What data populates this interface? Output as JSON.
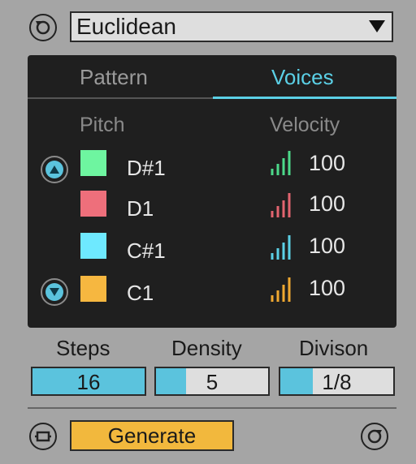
{
  "header": {
    "preset_value": "Euclidean"
  },
  "tabs": [
    {
      "label": "Pattern",
      "active": false
    },
    {
      "label": "Voices",
      "active": true
    }
  ],
  "columns": {
    "pitch": "Pitch",
    "velocity": "Velocity"
  },
  "voices": [
    {
      "note": "D#1",
      "color": "#6ef5a0",
      "velocity": "100",
      "icon": "velocity-bars-icon"
    },
    {
      "note": "D1",
      "color": "#ee6f7b",
      "velocity": "100",
      "icon": "velocity-bars-icon"
    },
    {
      "note": "C#1",
      "color": "#6ee9ff",
      "velocity": "100",
      "icon": "velocity-bars-icon"
    },
    {
      "note": "C1",
      "color": "#f6b740",
      "velocity": "100",
      "icon": "velocity-bars-icon"
    }
  ],
  "params": [
    {
      "label": "Steps",
      "value": "16",
      "fill": 1.0
    },
    {
      "label": "Density",
      "value": "5",
      "fill": 0.27
    },
    {
      "label": "Divison",
      "value": "1/8",
      "fill": 0.29
    }
  ],
  "footer": {
    "generate_label": "Generate"
  },
  "colors": {
    "accent": "#5bc3dd",
    "generate": "#f2b83d",
    "panel": "#1f1f1f",
    "background": "#a5a5a5"
  }
}
